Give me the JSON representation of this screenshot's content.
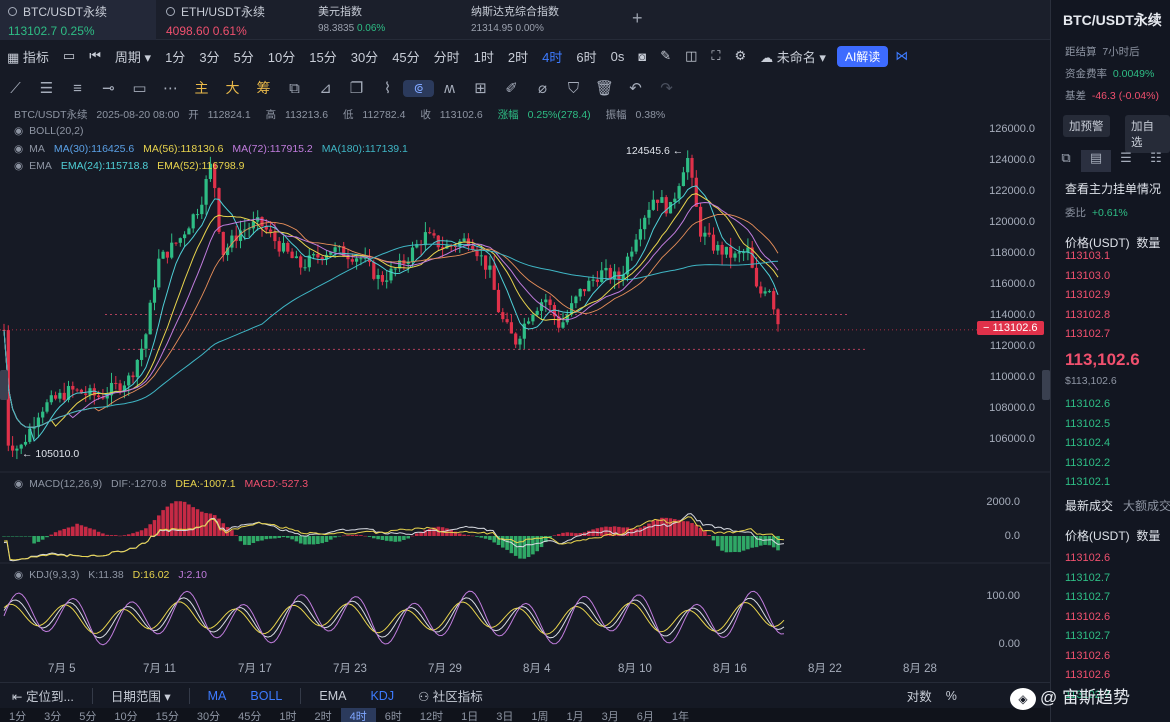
{
  "tabs": [
    {
      "name": "BTC/USDT永续",
      "price": "113102.7",
      "change": "0.25%"
    },
    {
      "name": "ETH/USDT永续",
      "price": "4098.60",
      "change": "0.61%"
    },
    {
      "name": "美元指数",
      "price": "98.3835",
      "change": "0.06%"
    },
    {
      "name": "纳斯达克综合指数",
      "price": "21314.95",
      "change": "0.00%"
    }
  ],
  "add_tab": "+",
  "toolbar": {
    "indicator": "指标",
    "period": "周期",
    "intervals": [
      "1分",
      "3分",
      "5分",
      "10分",
      "15分",
      "30分",
      "45分",
      "分时",
      "1时",
      "2时",
      "4时",
      "6时",
      "0s"
    ],
    "active_interval": "4时",
    "layout_name": "未命名",
    "ai_button": "AI解读"
  },
  "drawing_tools": {
    "chinese_tools": [
      "主",
      "大",
      "筹"
    ]
  },
  "legend": {
    "symbol": "BTC/USDT永续",
    "timestamp": "2025-08-20 08:00",
    "open_label": "开",
    "open": "112824.1",
    "high_label": "高",
    "high": "113213.6",
    "low_label": "低",
    "low": "112782.4",
    "close_label": "收",
    "close": "113102.6",
    "change_label": "涨幅",
    "change": "0.25%(278.4)",
    "amplitude_label": "振幅",
    "amplitude": "0.38%",
    "boll": "BOLL(20,2)",
    "ma_name": "MA",
    "ma30": "MA(30):116425.6",
    "ma56": "MA(56):118130.6",
    "ma72": "MA(72):117915.2",
    "ma180": "MA(180):117139.1",
    "ema_name": "EMA",
    "ema24": "EMA(24):115718.8",
    "ema52": "EMA(52):116798.9"
  },
  "annotations": {
    "high_marker": "124545.6",
    "low_marker": "105010.0",
    "current_price": "113102.6"
  },
  "price_axis": [
    "126000.0",
    "124000.0",
    "122000.0",
    "120000.0",
    "118000.0",
    "116000.0",
    "114000.0",
    "112000.0",
    "110000.0",
    "108000.0",
    "106000.0"
  ],
  "date_axis": [
    "7月 5",
    "7月 11",
    "7月 17",
    "7月 23",
    "7月 29",
    "8月 4",
    "8月 10",
    "8月 16",
    "8月 22",
    "8月 28"
  ],
  "macd": {
    "label": "MACD(12,26,9)",
    "dif": "DIF:-1270.8",
    "dea": "DEA:-1007.1",
    "macd": "MACD:-527.3",
    "axis": [
      "2000.0",
      "0.0"
    ]
  },
  "kdj": {
    "label": "KDJ(9,3,3)",
    "k": "K:11.38",
    "d": "D:16.02",
    "j": "J:2.10",
    "axis": [
      "100.00",
      "0.00"
    ]
  },
  "bottom_bar": {
    "locate": "定位到...",
    "date_range": "日期范围",
    "indicators": [
      "MA",
      "BOLL",
      "EMA",
      "KDJ"
    ],
    "community": "社区指标",
    "log": "对数",
    "percent": "%"
  },
  "bottom_strip": [
    "1分",
    "3分",
    "5分",
    "10分",
    "15分",
    "30分",
    "45分",
    "1时",
    "2时",
    "4时",
    "6时",
    "12时",
    "1日",
    "3日",
    "1周",
    "1月",
    "3月",
    "6月",
    "1年"
  ],
  "bottom_strip_selected": "4时",
  "right_panel": {
    "title": "BTC/USDT永续",
    "settlement_label": "距结算",
    "settlement": "7小时后",
    "funding_label": "资金费率",
    "funding": "0.0049%",
    "basis_label": "基差",
    "basis": "-46.3 (-0.04%)",
    "btn_alert": "加预警",
    "btn_watch": "加自选",
    "orderbook_title": "查看主力挂单情况",
    "ratio_label": "委比",
    "ratio": "+0.61%",
    "col_price": "价格(USDT)",
    "col_qty": "数量",
    "asks": [
      "113103.1",
      "113103.0",
      "113102.9",
      "113102.8",
      "113102.7"
    ],
    "last_price": "113,102.6",
    "last_price_sub": "$113,102.6",
    "bids": [
      "113102.6",
      "113102.5",
      "113102.4",
      "113102.2",
      "113102.1"
    ],
    "trades_tab": "最新成交",
    "trades_tab2": "大额成交",
    "trades": [
      {
        "price": "113102.6",
        "side": "sell"
      },
      {
        "price": "113102.7",
        "side": "buy"
      },
      {
        "price": "113102.7",
        "side": "buy"
      },
      {
        "price": "113102.6",
        "side": "sell"
      },
      {
        "price": "113102.7",
        "side": "buy"
      },
      {
        "price": "113102.6",
        "side": "sell"
      },
      {
        "price": "113102.6",
        "side": "sell"
      },
      {
        "price": "113102.7",
        "side": "buy"
      }
    ]
  },
  "watermark": "@ 宙斯趋势",
  "colors": {
    "up": "#2ebd85",
    "down": "#f0506e",
    "accent": "#3d7bff",
    "background": "#161a25"
  }
}
